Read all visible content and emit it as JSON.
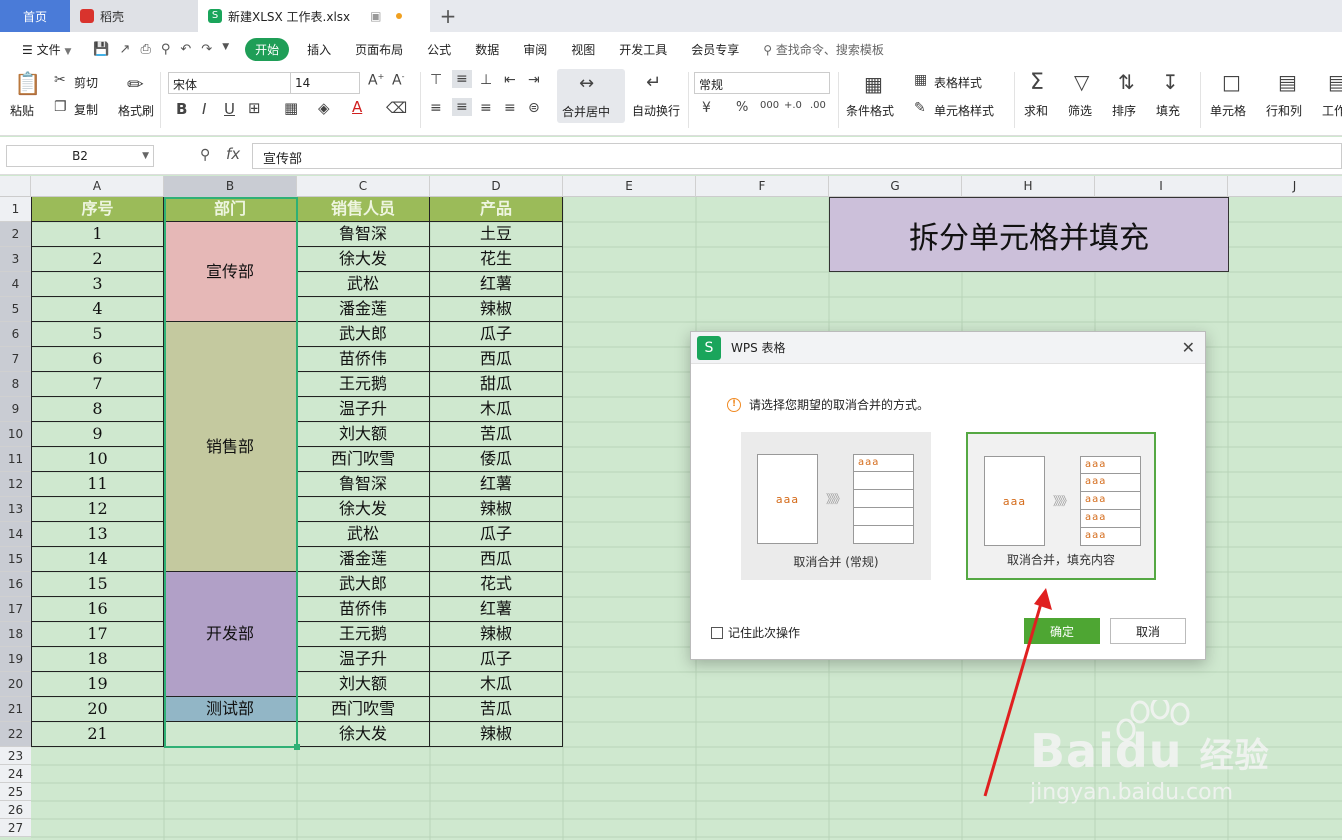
{
  "tabs": {
    "home": "首页",
    "daoke": "稻壳",
    "file": "新建XLSX 工作表.xlsx",
    "file_logo": "S",
    "plus": "+"
  },
  "menubar": {
    "file_menu": "文件",
    "items": [
      "开始",
      "插入",
      "页面布局",
      "公式",
      "数据",
      "审阅",
      "视图",
      "开发工具",
      "会员专享"
    ],
    "search": "查找命令、搜索模板"
  },
  "ribbon": {
    "paste": "粘贴",
    "cut": "剪切",
    "copy": "复制",
    "format_painter": "格式刷",
    "font_name": "宋体",
    "font_size": "14",
    "merge_center": "合并居中",
    "wrap_text": "自动换行",
    "number_format": "常规",
    "conditional_format": "条件格式",
    "table_style": "表格样式",
    "cell_style": "单元格样式",
    "sum": "求和",
    "filter": "筛选",
    "sort": "排序",
    "fill": "填充",
    "cells": "单元格",
    "rows_cols": "行和列",
    "worksheet": "工作",
    "percent": "%",
    "thousands": "000",
    "dec_inc": "+.0",
    "dec_dec": ".00"
  },
  "formula": {
    "name_box": "B2",
    "fx": "fx",
    "value": "宣传部"
  },
  "columns": [
    "A",
    "B",
    "C",
    "D",
    "E",
    "F",
    "G",
    "H",
    "I",
    "J"
  ],
  "rows": [
    "1",
    "2",
    "3",
    "4",
    "5",
    "6",
    "7",
    "8",
    "9",
    "10",
    "11",
    "12",
    "13",
    "14",
    "15",
    "16",
    "17",
    "18",
    "19",
    "20",
    "21",
    "22",
    "23",
    "24",
    "25",
    "26",
    "27"
  ],
  "table": {
    "headers": [
      "序号",
      "部门",
      "销售人员",
      "产品"
    ],
    "numbers": [
      "1",
      "2",
      "3",
      "4",
      "5",
      "6",
      "7",
      "8",
      "9",
      "10",
      "11",
      "12",
      "13",
      "14",
      "15",
      "16",
      "17",
      "18",
      "19",
      "20",
      "21"
    ],
    "salespeople": [
      "鲁智深",
      "徐大发",
      "武松",
      "潘金莲",
      "武大郎",
      "苗侨伟",
      "王元鹅",
      "温子升",
      "刘大额",
      "西门吹雪",
      "鲁智深",
      "徐大发",
      "武松",
      "潘金莲",
      "武大郎",
      "苗侨伟",
      "王元鹅",
      "温子升",
      "刘大额",
      "西门吹雪",
      "徐大发"
    ],
    "products": [
      "土豆",
      "花生",
      "红薯",
      "辣椒",
      "瓜子",
      "西瓜",
      "甜瓜",
      "木瓜",
      "苦瓜",
      "倭瓜",
      "红薯",
      "辣椒",
      "瓜子",
      "西瓜",
      "花式",
      "红薯",
      "辣椒",
      "瓜子",
      "木瓜",
      "苦瓜",
      "辣椒"
    ],
    "departments": [
      {
        "name": "宣传部",
        "color": "#e6b8b7"
      },
      {
        "name": "销售部",
        "color": "#c4c99f"
      },
      {
        "name": "开发部",
        "color": "#b1a0c7"
      },
      {
        "name": "测试部",
        "color": "#92b6c6"
      }
    ]
  },
  "title_box": "拆分单元格并填充",
  "dialog": {
    "logo": "S",
    "title": "WPS 表格",
    "close": "✕",
    "warn": "!",
    "prompt": "请选择您期望的取消合并的方式。",
    "sample": "aaa",
    "arrow": "》》》",
    "option1": "取消合并 (常规)",
    "option2": "取消合并，填充内容",
    "remember": "记住此次操作",
    "ok": "确定",
    "cancel": "取消"
  },
  "watermark": {
    "brand": "Bai",
    "brand_du": "du",
    "brand_cn": "经验",
    "url": "jingyan.baidu.com"
  },
  "colors": {
    "accent": "#1f9e57",
    "sheet_bg": "#cfe8cf",
    "header_fill": "#9bbb59",
    "selection": "#2fb075",
    "arrow": "#e02020"
  }
}
